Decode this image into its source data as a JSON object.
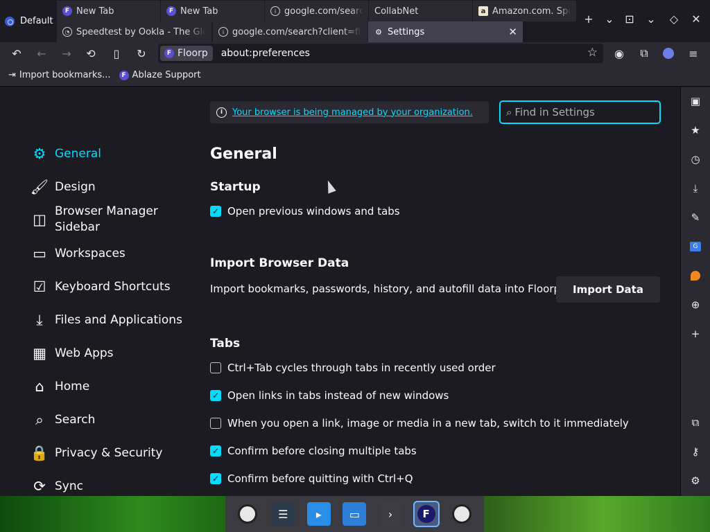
{
  "workspace": {
    "label": "Default"
  },
  "tabs_row1": [
    {
      "label": "New Tab",
      "icon": "floorp-icon"
    },
    {
      "label": "New Tab",
      "icon": "floorp-icon"
    },
    {
      "label": "google.com/search",
      "icon": "globe-icon"
    },
    {
      "label": "CollabNet",
      "icon": "none"
    },
    {
      "label": "Amazon.com. Spe",
      "icon": "amazon-icon"
    }
  ],
  "tabs_row2": [
    {
      "label": "Speedtest by Ookla - The Glob",
      "icon": "speedtest-icon"
    },
    {
      "label": "google.com/search?client=fire",
      "icon": "globe-icon"
    },
    {
      "label": "Settings",
      "icon": "gear-icon",
      "selected": true
    }
  ],
  "urlbar": {
    "identity_label": "Floorp",
    "url": "about:preferences"
  },
  "bookmarks": [
    {
      "label": "Import bookmarks...",
      "icon": "import-icon"
    },
    {
      "label": "Ablaze Support",
      "icon": "floorp-icon"
    }
  ],
  "notice": {
    "text": "Your browser is being managed by your organization."
  },
  "search": {
    "placeholder": "Find in Settings",
    "value": ""
  },
  "categories": [
    {
      "label": "General",
      "icon": "gear-icon",
      "active": true
    },
    {
      "label": "Design",
      "icon": "brush-icon"
    },
    {
      "label": "Browser Manager Sidebar",
      "icon": "sidebar-icon"
    },
    {
      "label": "Workspaces",
      "icon": "window-icon"
    },
    {
      "label": "Keyboard Shortcuts",
      "icon": "checkbox-icon"
    },
    {
      "label": "Files and Applications",
      "icon": "download-icon"
    },
    {
      "label": "Web Apps",
      "icon": "webapps-icon"
    },
    {
      "label": "Home",
      "icon": "home-icon"
    },
    {
      "label": "Search",
      "icon": "search-icon"
    },
    {
      "label": "Privacy & Security",
      "icon": "lock-icon"
    },
    {
      "label": "Sync",
      "icon": "sync-icon"
    }
  ],
  "pane": {
    "title": "General",
    "startup": {
      "title": "Startup",
      "options": [
        {
          "label": "Open previous windows and tabs",
          "checked": true
        }
      ]
    },
    "import": {
      "title": "Import Browser Data",
      "description": "Import bookmarks, passwords, history, and autofill data into Floorp.",
      "button": "Import Data"
    },
    "tabs": {
      "title": "Tabs",
      "options": [
        {
          "label": "Ctrl+Tab cycles through tabs in recently used order",
          "checked": false
        },
        {
          "label": "Open links in tabs instead of new windows",
          "checked": true
        },
        {
          "label": "When you open a link, image or media in a new tab, switch to it immediately",
          "checked": false
        },
        {
          "label": "Confirm before closing multiple tabs",
          "checked": true
        },
        {
          "label": "Confirm before quitting with Ctrl+Q",
          "checked": true
        }
      ]
    }
  },
  "colors": {
    "accent": "#00ddff",
    "background": "#1c1b22",
    "toolbar": "#2b2a33"
  }
}
